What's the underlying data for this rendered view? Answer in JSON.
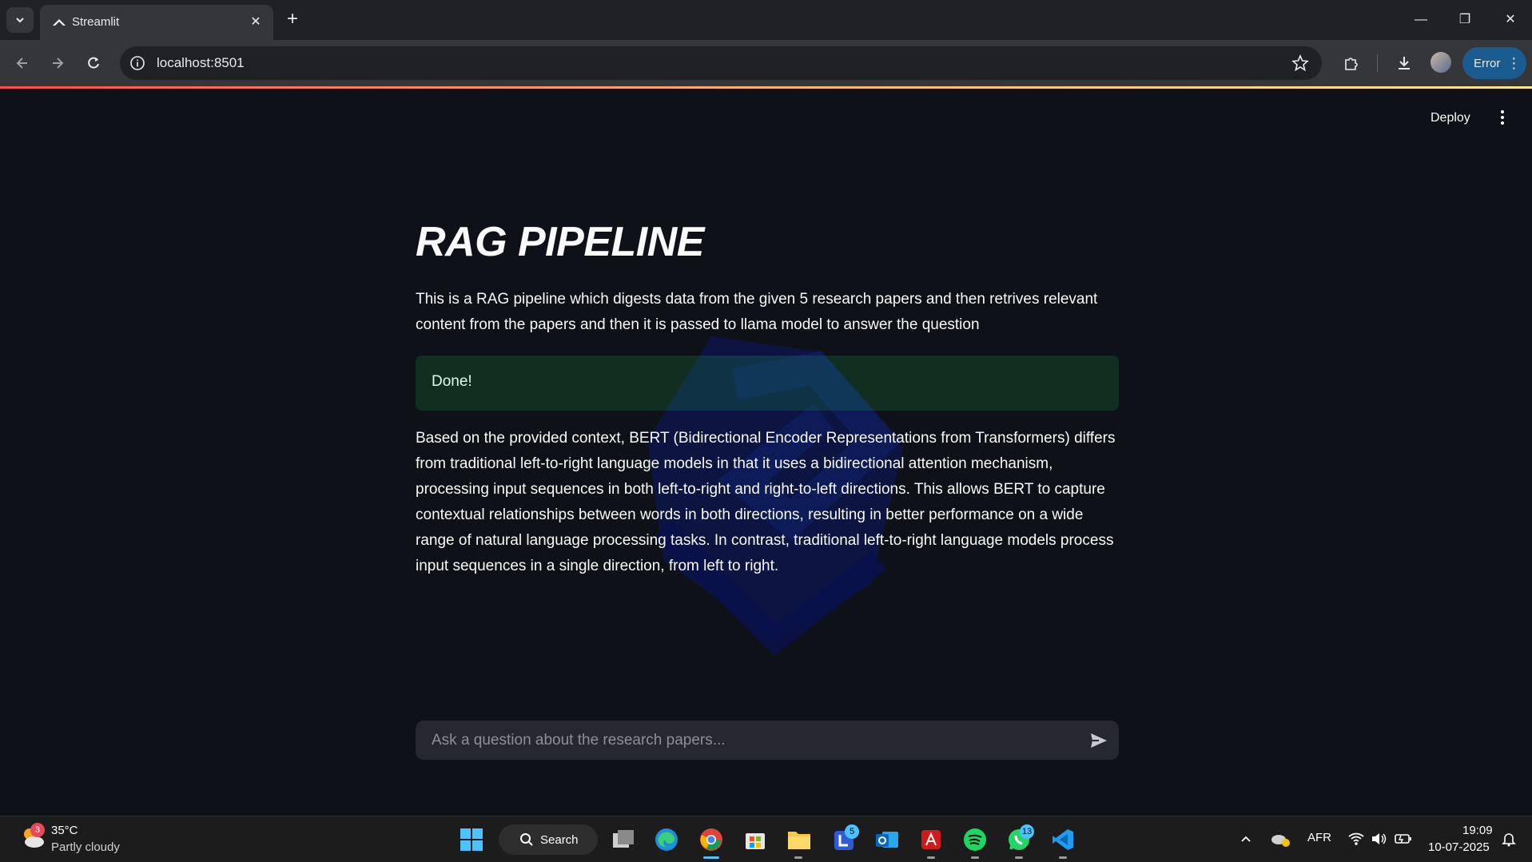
{
  "browser": {
    "tab_title": "Streamlit",
    "url": "localhost:8501",
    "profile_status": "Error"
  },
  "app": {
    "deploy_label": "Deploy",
    "title": "RAG PIPELINE",
    "intro": "This is a RAG pipeline which digests data from the given 5 research papers and then retrives relevant content from the papers and then it is passed to llama model to answer the question",
    "status_message": "Done!",
    "answer": "Based on the provided context, BERT (Bidirectional Encoder Representations from Transformers) differs from traditional left-to-right language models in that it uses a bidirectional attention mechanism, processing input sequences in both left-to-right and right-to-left directions. This allows BERT to capture contextual relationships between words in both directions, resulting in better performance on a wide range of natural language processing tasks. In contrast, traditional left-to-right language models process input sequences in a single direction, from left to right.",
    "chat_placeholder": "Ask a question about the research papers..."
  },
  "taskbar": {
    "weather_badge": "3",
    "weather_temp": "35°C",
    "weather_desc": "Partly cloudy",
    "search_label": "Search",
    "teams_badge": "5",
    "whatsapp_badge": "13",
    "language": "AFR",
    "time": "19:09",
    "date": "10-07-2025"
  },
  "colors": {
    "app_background": "#0e1117",
    "success_background": "#1e3a2c",
    "accent_error_pill": "#1a5c8f"
  }
}
